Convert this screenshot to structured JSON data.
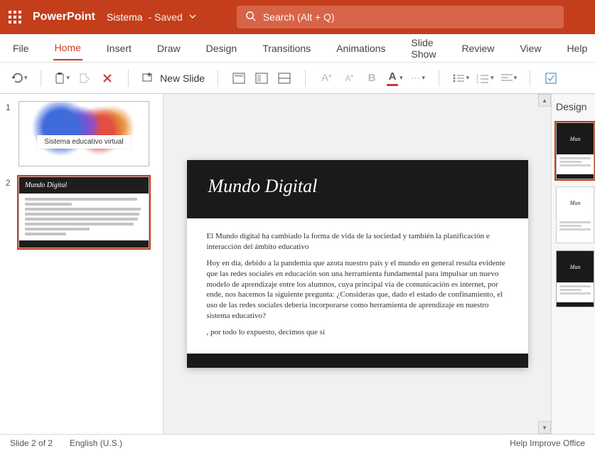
{
  "titlebar": {
    "app_name": "PowerPoint",
    "doc_name": "Sistema",
    "save_state": "- Saved",
    "search_placeholder": "Search (Alt + Q)"
  },
  "tabs": [
    "File",
    "Home",
    "Insert",
    "Draw",
    "Design",
    "Transitions",
    "Animations",
    "Slide Show",
    "Review",
    "View",
    "Help"
  ],
  "active_tab_index": 1,
  "toolbar": {
    "new_slide_label": "New Slide"
  },
  "thumbnails": {
    "slide1": {
      "number": "1",
      "caption": "Sistema educativo virtual"
    },
    "slide2": {
      "number": "2",
      "title": "Mundo Digital"
    }
  },
  "slide": {
    "title": "Mundo Digital",
    "p1": "El Mundo digital ha cambiado la forma de vida de la sociedad y también la planificación e interacción del ámbito educativo",
    "p2": "Hoy en día, debido a la pandemia que azota nuestro país y el mundo en general resulta evidente que las redes sociales en educación son una herramienta fundamental para impulsar un nuevo modelo de aprendizaje entre los alumnos, cuya principal vía de comunicación es internet, por ende, nos hacemos la siguiente pregunta: ¿Consideras que, dado el estado de confinamiento, el uso de las redes sociales debería incorporarse como herramienta de aprendizaje en nuestro sistema educativo?",
    "p3": ", por todo lo expuesto, decimos que sí"
  },
  "design_pane": {
    "header": "Design",
    "thumb_label": "Mun"
  },
  "status": {
    "slide_pos": "Slide 2 of 2",
    "lang": "English (U.S.)",
    "help": "Help Improve Office"
  }
}
